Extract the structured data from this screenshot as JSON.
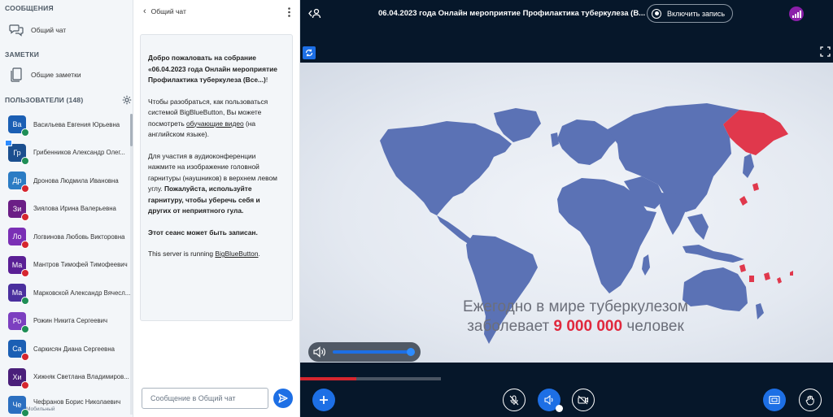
{
  "sidebar": {
    "messages_title": "СООБЩЕНИЯ",
    "public_chat": "Общий чат",
    "notes_title": "ЗАМЕТКИ",
    "shared_notes": "Общие заметки",
    "users_title": "ПОЛЬЗОВАТЕЛИ (148)",
    "users": [
      {
        "initials": "Ва",
        "name": "Васильева Евгения Юрьевна",
        "color": "#1b5fb4",
        "status": "#1f8e56"
      },
      {
        "initials": "Гр",
        "name": "Грибенников Александр Олег...",
        "color": "#1b4f8f",
        "status": "#1f8e56",
        "presenter": true
      },
      {
        "initials": "Др",
        "name": "Дронова Людмила Ивановна",
        "color": "#2b7cc4",
        "status": "#d6262f"
      },
      {
        "initials": "Зи",
        "name": "Зиялова Ирина Валерьевна",
        "color": "#6b1e86",
        "status": "#d6262f"
      },
      {
        "initials": "Ло",
        "name": "Логвинова Любовь Викторовна",
        "color": "#7a2fb5",
        "status": "#d6262f"
      },
      {
        "initials": "Ма",
        "name": "Мантров Тимофей Тимофеевич",
        "color": "#5a1f95",
        "status": "#d6262f"
      },
      {
        "initials": "Ма",
        "name": "Марковской Александр Вячесл...",
        "color": "#4a2f9e",
        "status": "#1f8e56"
      },
      {
        "initials": "Ро",
        "name": "Рожин Никита Сергеевич",
        "color": "#7c3fc0",
        "status": "#1f8e56"
      },
      {
        "initials": "Са",
        "name": "Саркисян Диана Сергеевна",
        "color": "#1b5fb4",
        "status": "#d6262f"
      },
      {
        "initials": "Хи",
        "name": "Хижняк Светлана Владимиров...",
        "color": "#4a1f7a",
        "status": "#d6262f"
      },
      {
        "initials": "Че",
        "name": "Чефранов Борис Николаевич",
        "sub": "Мобильный",
        "color": "#2b6fc0",
        "status": "#1f8e56"
      }
    ]
  },
  "chat": {
    "title": "Общий чат",
    "welcome": {
      "p1_pre": "Добро пожаловать на собрание «06.04.2023 ",
      "p1_bold": "года Онлайн мероприятие Профилактика туберкулеза (Все...)",
      "p1_post": "!",
      "p2_pre": "Чтобы разобраться, как пользоваться системой BigBlueButton, Вы можете посмотреть ",
      "p2_link": "обучающие видео",
      "p2_post": " (на английском языке).",
      "p3_a": "Для участия в аудиоконференции нажмите на изображение головной гарнитуры (наушников) в верхнем левом углу. ",
      "p3_b": "Пожалуйста, используйте гарнитуру, чтобы уберечь себя и других от неприятного гула.",
      "p4": "Этот сеанс может быть записан.",
      "p5_pre": "This server is running ",
      "p5_link": "BigBlueButton",
      "p5_post": "."
    },
    "input_placeholder": "Сообщение в Общий чат"
  },
  "topbar": {
    "meeting_title": "06.04.2023 года Онлайн мероприятие Профилактика туберкулеза (В...",
    "record_label": "Включить запись"
  },
  "slide": {
    "line1": "Ежегодно в мире туберкулезом",
    "line2_pre": "заболевает ",
    "line2_num": "9 000 000",
    "line2_post": " человек"
  },
  "video": {
    "volume": 1.0,
    "played_fraction": 0.105,
    "buffered_fraction": 0.264
  },
  "colors": {
    "accent": "#1d6fe5",
    "dark_bg": "#06172a",
    "map_blue": "#5b72b5",
    "map_red": "#e0384c"
  }
}
